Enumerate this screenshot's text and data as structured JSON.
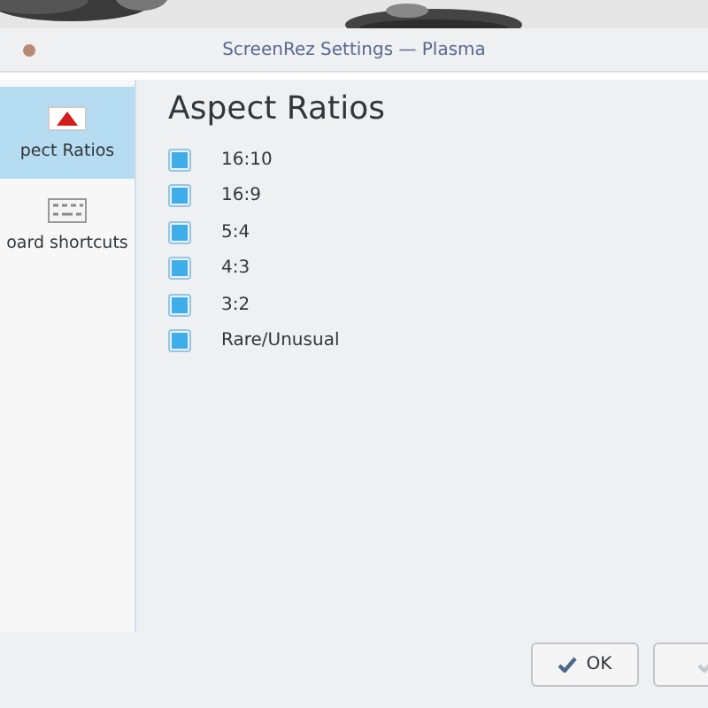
{
  "window": {
    "title": "ScreenRez Settings — Plasma"
  },
  "sidebar": {
    "items": [
      {
        "label": "pect Ratios",
        "kind": "triangle",
        "selected": true
      },
      {
        "label": "oard shortcuts",
        "kind": "keyboard",
        "selected": false
      }
    ]
  },
  "page": {
    "heading": "Aspect Ratios",
    "options": [
      {
        "label": "16:10",
        "checked": true
      },
      {
        "label": "16:9",
        "checked": true
      },
      {
        "label": "5:4",
        "checked": true
      },
      {
        "label": "4:3",
        "checked": true
      },
      {
        "label": "3:2",
        "checked": true
      },
      {
        "label": "Rare/Unusual",
        "checked": true
      }
    ]
  },
  "buttons": [
    {
      "label": "OK",
      "disabled": false
    },
    {
      "disabled": true
    }
  ]
}
